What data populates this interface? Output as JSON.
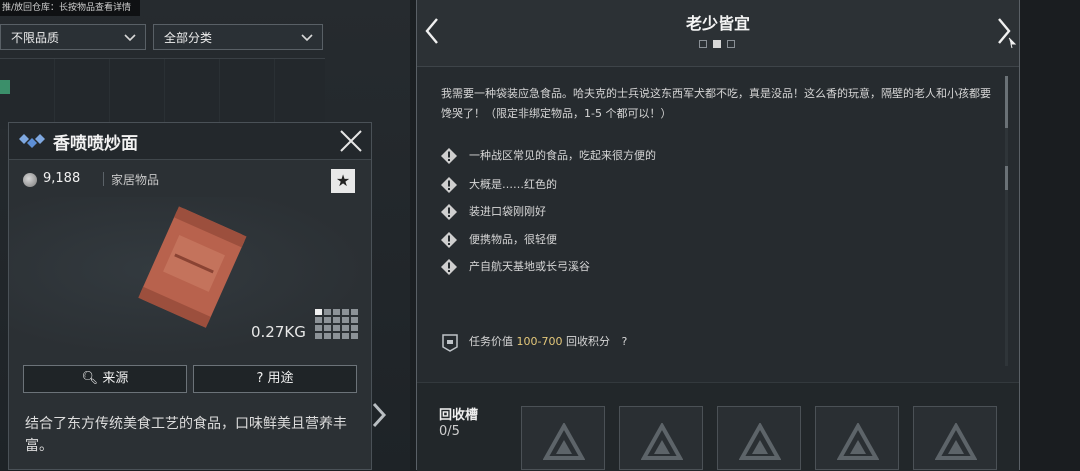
{
  "hint": "推/放回仓库：长按物品查看详情",
  "filters": {
    "quality": "不限品质",
    "category": "全部分类"
  },
  "item": {
    "name": "香喷喷炒面",
    "price": "9,188",
    "category": "家居物品",
    "weight": "0.27KG",
    "source_label": "来源",
    "usage_label": "用途",
    "description": "结合了东方传统美食工艺的食品，口味鲜美且营养丰富。"
  },
  "quest": {
    "title": "老少皆宜",
    "description": "我需要一种袋装应急食品。哈夫克的士兵说这东西军犬都不吃，真是没品！这么香的玩意，隔壁的老人和小孩都要馋哭了！（限定非绑定物品，1-5 个都可以！）",
    "clues": [
      "一种战区常见的食品，吃起来很方便的",
      "大概是……红色的",
      "装进口袋刚刚好",
      "便携物品，很轻便",
      "产自航天基地或长弓溪谷"
    ],
    "reward_prefix": "任务价值",
    "reward_range": "100-700",
    "reward_suffix": "回收积分",
    "reward_help": "?",
    "recycle_label": "回收槽",
    "recycle_count": "0/5"
  },
  "icons": {
    "prev": "chevron-left-icon",
    "next": "chevron-right-icon",
    "close": "close-icon",
    "star": "star-icon",
    "search": "search-icon",
    "clue": "warning-diamond-icon",
    "slot": "triangle-logo-icon"
  },
  "colors": {
    "accent": "#e3c77a",
    "panel": "#262b2f",
    "item_bag": "#c06a52"
  }
}
